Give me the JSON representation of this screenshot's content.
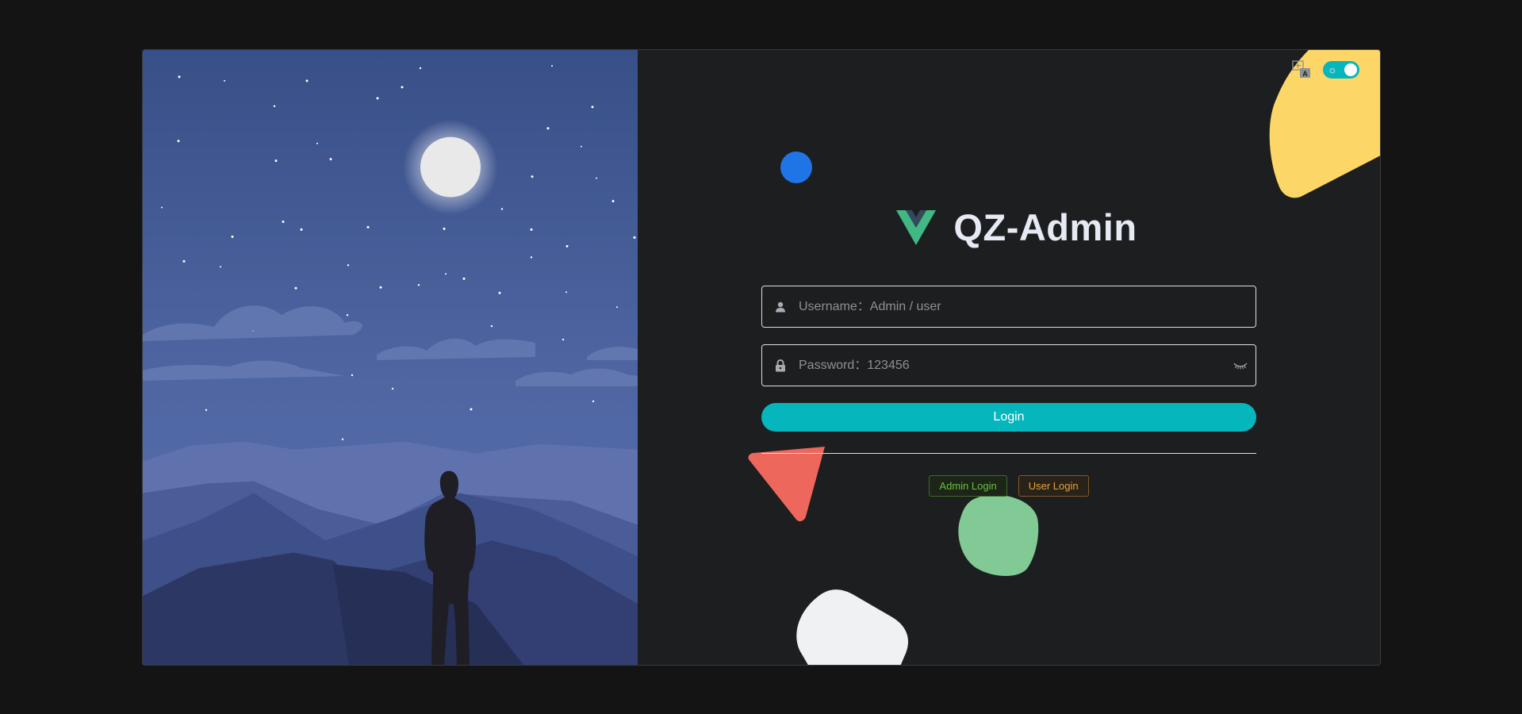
{
  "app": {
    "title": "QZ-Admin",
    "logo": "vue-logo-icon"
  },
  "topbar": {
    "translate_icon": "translate-icon",
    "theme_icon": "sun-icon",
    "theme_toggle_on": true
  },
  "form": {
    "username": {
      "placeholder": "Username：Admin / user",
      "value": "",
      "icon": "user-icon"
    },
    "password": {
      "placeholder": "Password：123456",
      "value": "",
      "icon": "lock-icon",
      "toggle_icon": "eye-closed-icon"
    },
    "login_label": "Login"
  },
  "quick_login": {
    "admin_label": "Admin Login",
    "user_label": "User Login"
  },
  "colors": {
    "accent": "#06b6bd",
    "background": "#141414",
    "card": "#1d1e1f",
    "admin": "#67c23a",
    "user": "#e6a23c",
    "deco_blue": "#1f74e6",
    "deco_yellow": "#fcd666",
    "deco_red": "#ee675c",
    "deco_green": "#81c995",
    "deco_white": "#f0f1f3"
  }
}
